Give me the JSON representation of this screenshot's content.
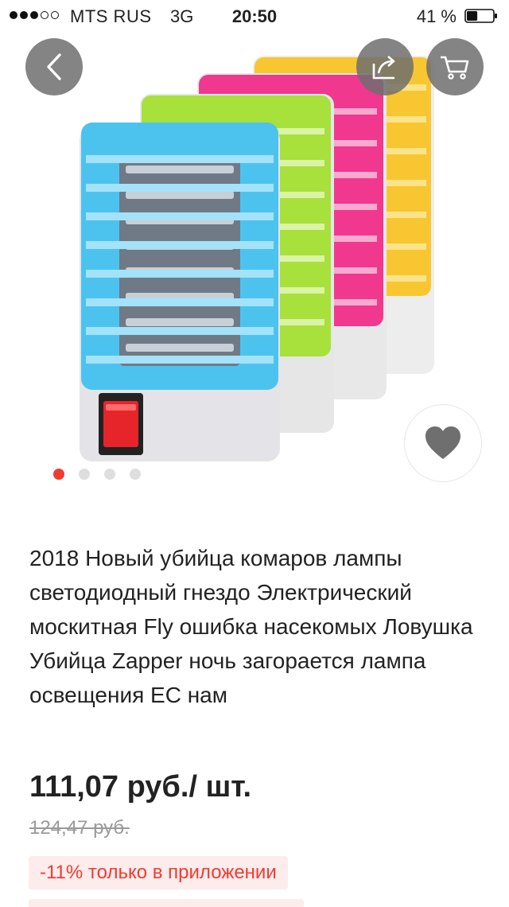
{
  "status_bar": {
    "carrier": "MTS RUS",
    "network": "3G",
    "time": "20:50",
    "battery": "41 %",
    "battery_level": 0.41,
    "signal_dots_filled": 3,
    "signal_dots_total": 5
  },
  "gallery": {
    "back_icon": "chevron-left-icon",
    "share_icon": "share-icon",
    "cart_icon": "cart-icon",
    "favorite_icon": "heart-icon",
    "page_count": 4,
    "active_page": 1,
    "image_colors": [
      "#4cc3ef",
      "#a8e03c",
      "#f0388f",
      "#f8c630"
    ]
  },
  "product": {
    "title": "2018 Новый убийца комаров лампы светодиодный гнездо Электрический москитная Fly ошибка насекомых Ловушка Убийца Zapper ночь загорается лампа освещения ЕС нам",
    "price": "111,07 руб./ шт.",
    "old_price": "124,47 руб.",
    "discount": "-11% только в приложении"
  },
  "colors": {
    "accent": "#f23b2f",
    "badge_bg": "#fdecec"
  }
}
